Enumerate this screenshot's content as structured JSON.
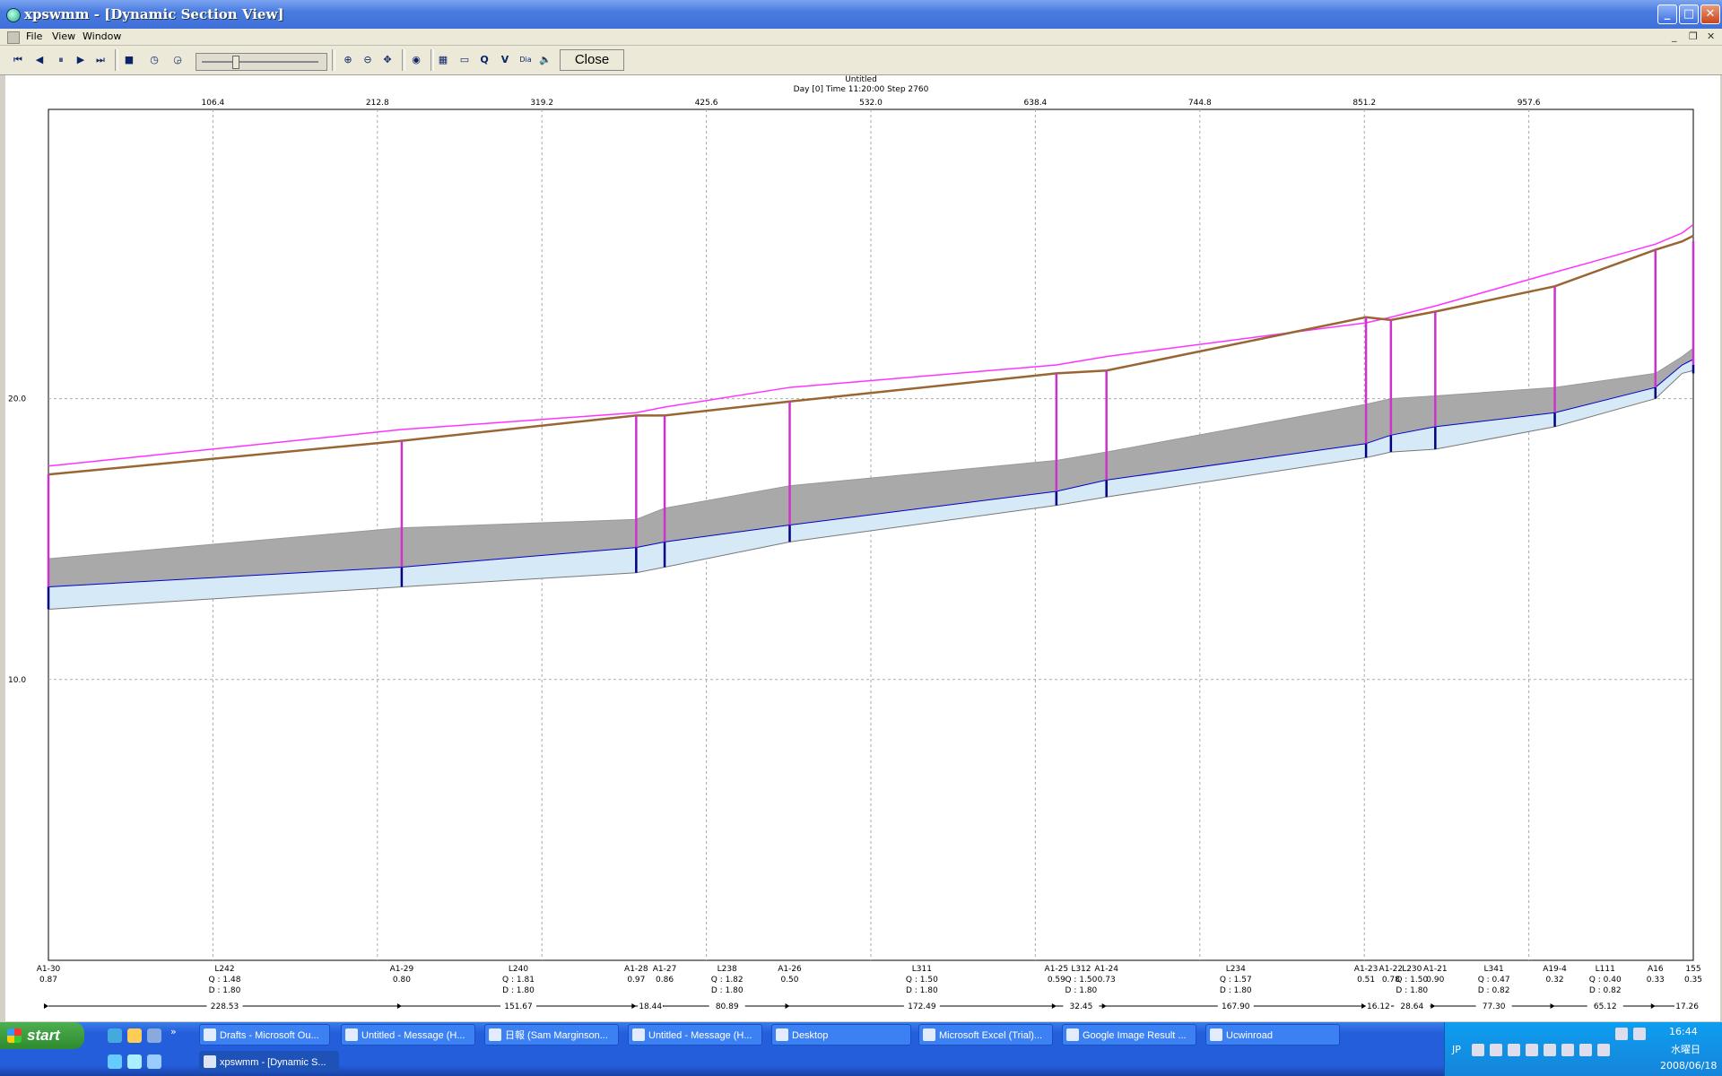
{
  "window": {
    "title": "xpswmm - [Dynamic Section View]",
    "buttons": [
      "_",
      "□",
      "✕"
    ]
  },
  "menu": [
    "File",
    "View",
    "Window"
  ],
  "toolbar": {
    "close_label": "Close",
    "q_label": "Q",
    "v_label": "V",
    "dia_label": "Dia"
  },
  "chart_data": {
    "type": "line",
    "title": "Untitled",
    "subtitle": "Day [0] Time 11:20:00 Step 2760",
    "x_ticks": [
      "106.4",
      "212.8",
      "319.2",
      "425.6",
      "532.0",
      "638.4",
      "744.8",
      "851.2",
      "957.6"
    ],
    "y_ticks": [
      "20.0",
      "10.0"
    ],
    "xlim": [
      0,
      1064
    ],
    "ylim": [
      0,
      30.3
    ],
    "series": [
      {
        "name": "ground",
        "color": "#ff33ff",
        "x": [
          0,
          228.53,
          380.2,
          398.6,
          479.5,
          652.0,
          684.4,
          852.3,
          868.4,
          897.1,
          974.4,
          1039.5,
          1056.8,
          1064
        ],
        "y": [
          17.6,
          18.9,
          19.5,
          19.7,
          20.4,
          21.2,
          21.5,
          22.7,
          22.9,
          23.3,
          24.5,
          25.5,
          25.9,
          26.2
        ]
      },
      {
        "name": "hgl",
        "color": "#996633",
        "x": [
          0,
          228.53,
          380.2,
          398.6,
          479.5,
          652.0,
          684.4,
          852.3,
          868.4,
          897.1,
          974.4,
          1039.5,
          1056.8,
          1064
        ],
        "y": [
          17.3,
          18.5,
          19.4,
          19.4,
          19.9,
          20.9,
          21.0,
          22.9,
          22.8,
          23.1,
          24.0,
          25.3,
          25.6,
          25.8
        ]
      },
      {
        "name": "water",
        "color": "#0000cc",
        "x": [
          0,
          228.53,
          380.2,
          398.6,
          479.5,
          652.0,
          684.4,
          852.3,
          868.4,
          897.1,
          974.4,
          1039.5,
          1056.8,
          1064
        ],
        "y": [
          13.3,
          14.0,
          14.7,
          14.9,
          15.5,
          16.7,
          17.1,
          18.4,
          18.7,
          19.0,
          19.5,
          20.4,
          21.2,
          21.4
        ]
      },
      {
        "name": "pipe_crown",
        "color": "#999999",
        "x": [
          0,
          228.53,
          380.2,
          398.6,
          479.5,
          652.0,
          684.4,
          852.3,
          868.4,
          897.1,
          974.4,
          1039.5,
          1056.8,
          1064
        ],
        "y": [
          14.3,
          15.4,
          15.7,
          16.1,
          16.9,
          17.8,
          18.1,
          19.8,
          20.0,
          20.1,
          20.4,
          20.9,
          21.5,
          21.8
        ]
      },
      {
        "name": "pipe_invert",
        "color": "#777777",
        "x": [
          0,
          228.53,
          380.2,
          398.6,
          479.5,
          652.0,
          684.4,
          852.3,
          868.4,
          897.1,
          974.4,
          1039.5,
          1056.8,
          1064
        ],
        "y": [
          12.5,
          13.3,
          13.8,
          14.0,
          14.9,
          16.2,
          16.5,
          17.9,
          18.1,
          18.2,
          19.0,
          20.0,
          20.9,
          21.0
        ]
      }
    ],
    "nodes": [
      {
        "name": "A1-30",
        "depth": "0.87",
        "x": 0
      },
      {
        "name": "A1-29",
        "depth": "0.80",
        "x": 228.53
      },
      {
        "name": "A1-28",
        "depth": "0.97",
        "x": 380.2
      },
      {
        "name": "A1-27",
        "depth": "0.86",
        "x": 398.6
      },
      {
        "name": "A1-26",
        "depth": "0.50",
        "x": 479.5
      },
      {
        "name": "A1-25",
        "depth": "0.59",
        "x": 652.0
      },
      {
        "name": "A1-24",
        "depth": "0.73",
        "x": 684.4
      },
      {
        "name": "A1-23",
        "depth": "0.51",
        "x": 852.3
      },
      {
        "name": "A1-22",
        "depth": "0.78",
        "x": 868.4
      },
      {
        "name": "A1-21",
        "depth": "0.90",
        "x": 897.1
      },
      {
        "name": "A19-4",
        "depth": "0.32",
        "x": 974.4
      },
      {
        "name": "A16",
        "depth": "0.33",
        "x": 1039.5
      },
      {
        "name": "155",
        "depth": "0.35",
        "x": 1064
      }
    ],
    "links": [
      {
        "name": "L242",
        "q": "1.48",
        "d": "1.80",
        "length": "228.53",
        "xmid": 114
      },
      {
        "name": "L240",
        "q": "1.81",
        "d": "1.80",
        "length": "151.67",
        "xmid": 304
      },
      {
        "name": "L238",
        "q": "1.82",
        "d": "1.80",
        "length": "80.89",
        "xmid": 439
      },
      {
        "name": "L311",
        "q": "1.50",
        "d": "1.80",
        "length": "172.49",
        "xmid": 565
      },
      {
        "name": "L312",
        "q": "1.50",
        "d": "1.80",
        "length": "32.45",
        "xmid": 668
      },
      {
        "name": "L234",
        "q": "1.57",
        "d": "1.80",
        "length": "167.90",
        "xmid": 768
      },
      {
        "name": "L230",
        "q": "1.50",
        "d": "1.80",
        "length": "28.64",
        "xmid": 882
      },
      {
        "name": "L341",
        "q": "0.47",
        "d": "0.82",
        "length": "77.30",
        "xmid": 935
      },
      {
        "name": "L111",
        "q": "0.40",
        "d": "0.82",
        "length": "65.12",
        "xmid": 1007
      }
    ],
    "small_lengths": [
      "18.44",
      "16.12",
      "17.26"
    ],
    "grid": true
  },
  "taskbar": {
    "start_label": "start",
    "tasks": [
      "Drafts - Microsoft Ou...",
      "Untitled - Message (H...",
      "日報 (Sam Marginson...",
      "Untitled - Message (H...",
      "Desktop",
      "Microsoft Excel (Trial)...",
      "Google Image Result ...",
      "Ucwinroad",
      "xpswmm - [Dynamic S..."
    ],
    "clock": "16:44",
    "day": "水曜日",
    "date": "2008/06/18",
    "lang": "JP"
  }
}
